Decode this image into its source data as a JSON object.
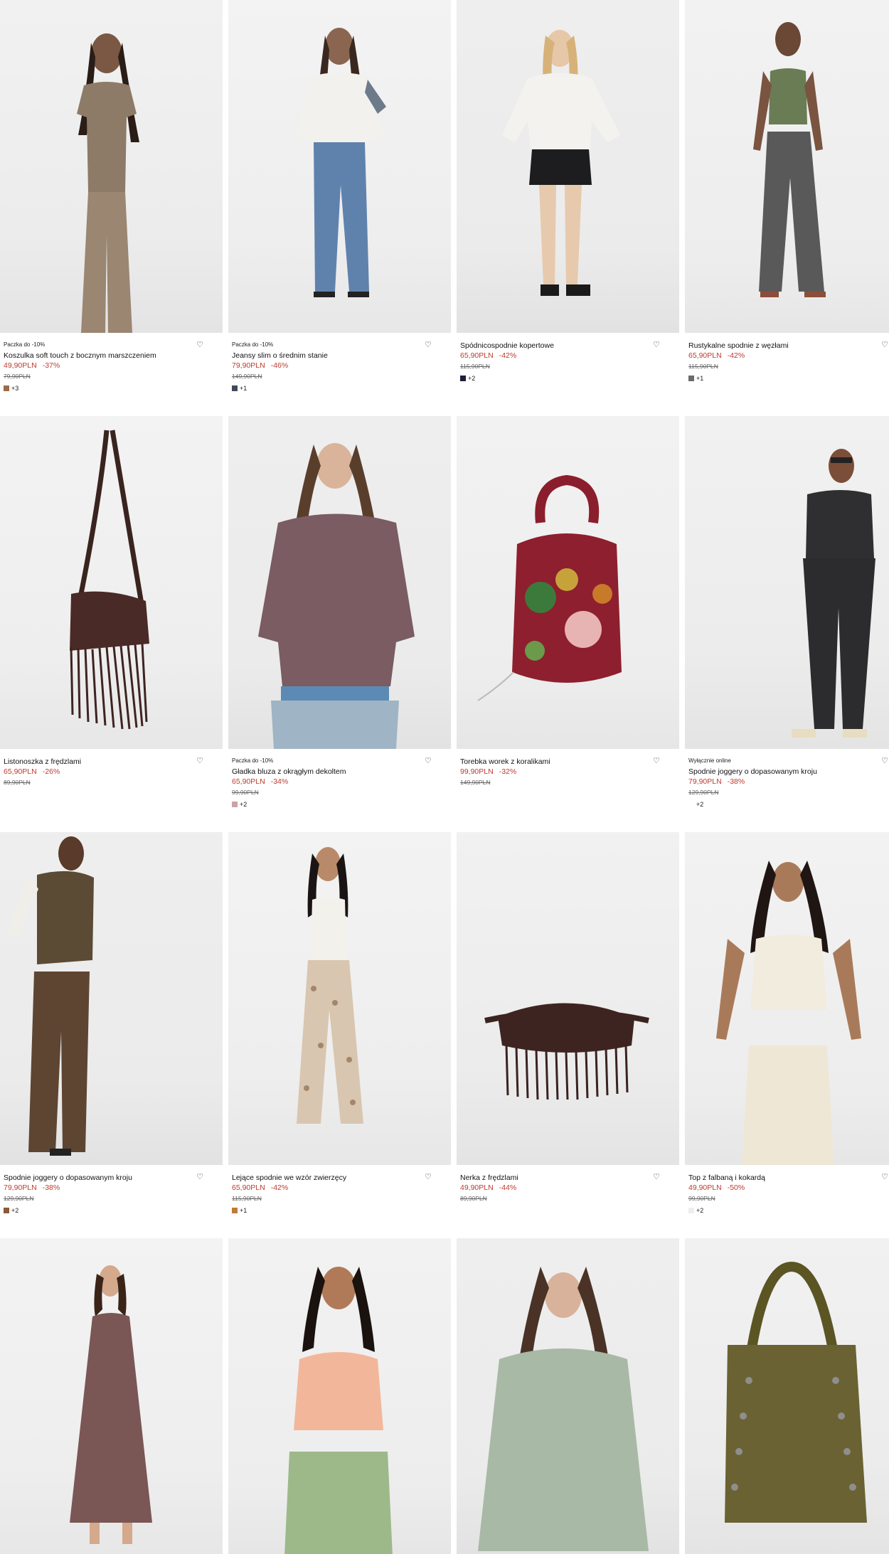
{
  "products": [
    {
      "tag": "Paczka do -10%",
      "name": "Koszulka soft touch z bocznym marszczeniem",
      "price": "49,90PLN",
      "discount": "-37%",
      "old_price": "79,90PLN",
      "swatch": "#9a6b4b",
      "more_colors": "+3",
      "image": "model-tshirt-icon"
    },
    {
      "tag": "Paczka do -10%",
      "name": "Jeansy slim o średnim stanie",
      "price": "79,90PLN",
      "discount": "-46%",
      "old_price": "149,90PLN",
      "swatch": "#3e4a58",
      "more_colors": "+1",
      "image": "model-jeans-icon"
    },
    {
      "tag": "",
      "name": "Spódnicospodnie kopertowe",
      "price": "65,90PLN",
      "discount": "-42%",
      "old_price": "115,90PLN",
      "swatch": "#1c1f3a",
      "more_colors": "+2",
      "image": "model-skort-icon"
    },
    {
      "tag": "",
      "name": "Rustykalne spodnie z węzłami",
      "price": "65,90PLN",
      "discount": "-42%",
      "old_price": "115,90PLN",
      "swatch": "#6b6b6b",
      "more_colors": "+1",
      "image": "model-pants-icon"
    },
    {
      "tag": "",
      "name": "Listonoszka z frędzlami",
      "price": "65,90PLN",
      "discount": "-26%",
      "old_price": "89,90PLN",
      "swatch": "",
      "more_colors": "",
      "image": "fringe-bag-icon"
    },
    {
      "tag": "Paczka do -10%",
      "name": "Gładka bluza z okrągłym dekoltem",
      "price": "65,90PLN",
      "discount": "-34%",
      "old_price": "99,90PLN",
      "swatch": "#c9a5a5",
      "more_colors": "+2",
      "image": "model-sweatshirt-icon"
    },
    {
      "tag": "",
      "name": "Torebka worek z koralikami",
      "price": "99,90PLN",
      "discount": "-32%",
      "old_price": "149,90PLN",
      "swatch": "",
      "more_colors": "",
      "image": "beaded-bag-icon"
    },
    {
      "tag": "Wyłącznie online",
      "name": "Spodnie joggery o dopasowanym kroju",
      "price": "79,90PLN",
      "discount": "-38%",
      "old_price": "129,90PLN",
      "swatch": "",
      "more_colors": "+2",
      "image": "model-joggers-icon"
    },
    {
      "tag": "",
      "name": "Spodnie joggery o dopasowanym kroju",
      "price": "79,90PLN",
      "discount": "-38%",
      "old_price": "129,90PLN",
      "swatch": "#8a5a3a",
      "more_colors": "+2",
      "image": "model-brown-set-icon"
    },
    {
      "tag": "",
      "name": "Lejące spodnie we wzór zwierzęcy",
      "price": "65,90PLN",
      "discount": "-42%",
      "old_price": "115,90PLN",
      "swatch": "#c07a3a",
      "more_colors": "+1",
      "image": "model-print-pants-icon"
    },
    {
      "tag": "",
      "name": "Nerka z frędzlami",
      "price": "49,90PLN",
      "discount": "-44%",
      "old_price": "89,90PLN",
      "swatch": "",
      "more_colors": "",
      "image": "fringe-beltbag-icon"
    },
    {
      "tag": "",
      "name": "Top z falbaną i kokardą",
      "price": "49,90PLN",
      "discount": "-50%",
      "old_price": "99,90PLN",
      "swatch": "#eeeeee",
      "more_colors": "+2",
      "image": "model-ruffle-top-icon"
    },
    {
      "tag": "",
      "name": "",
      "price": "",
      "discount": "",
      "old_price": "",
      "swatch": "",
      "more_colors": "",
      "image": "model-slip-dress-icon"
    },
    {
      "tag": "",
      "name": "",
      "price": "",
      "discount": "",
      "old_price": "",
      "swatch": "",
      "more_colors": "",
      "image": "model-peach-top-icon"
    },
    {
      "tag": "",
      "name": "",
      "price": "",
      "discount": "",
      "old_price": "",
      "swatch": "",
      "more_colors": "",
      "image": "model-green-sweater-icon"
    },
    {
      "tag": "",
      "name": "",
      "price": "",
      "discount": "",
      "old_price": "",
      "swatch": "",
      "more_colors": "",
      "image": "studded-tote-icon"
    }
  ],
  "colors": {
    "sale_red": "#c0392b",
    "text": "#111111",
    "photo_bg": "#efefef"
  }
}
